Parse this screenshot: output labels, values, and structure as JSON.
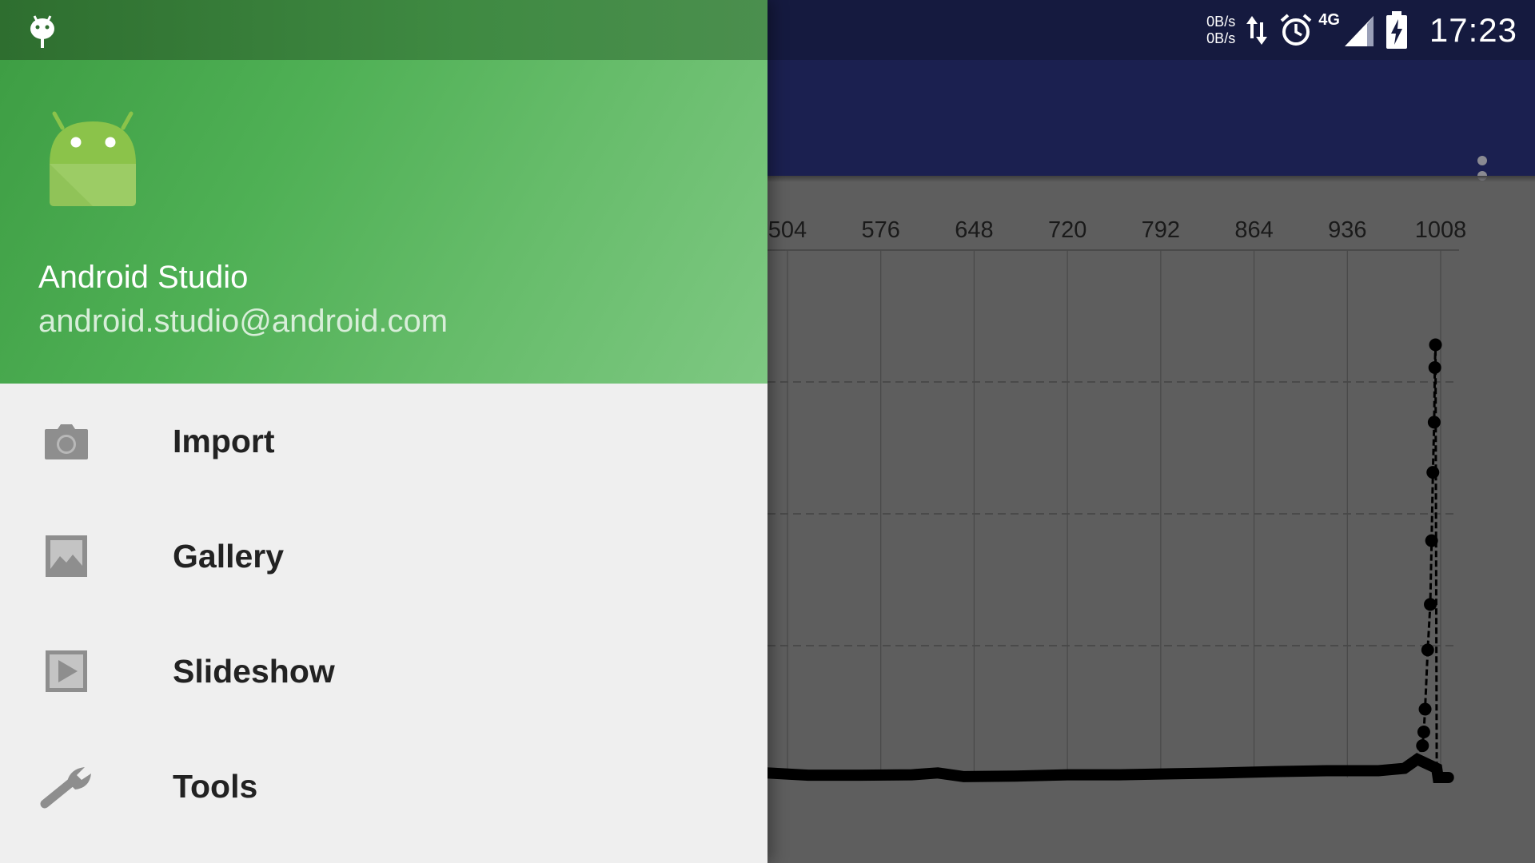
{
  "status_bar": {
    "net_up": "0B/s",
    "net_down": "0B/s",
    "network_type": "4G",
    "time": "17:23"
  },
  "drawer": {
    "header": {
      "name": "Android Studio",
      "email": "android.studio@android.com"
    },
    "items": [
      {
        "label": "Import",
        "icon": "camera-icon"
      },
      {
        "label": "Gallery",
        "icon": "gallery-icon"
      },
      {
        "label": "Slideshow",
        "icon": "slideshow-icon"
      },
      {
        "label": "Tools",
        "icon": "wrench-icon"
      }
    ]
  },
  "colors": {
    "header_green": "#4caf50",
    "app_toolbar": "#1b2050",
    "scrim_gray": "#5e5e5e"
  },
  "chart_data": {
    "type": "line",
    "x_ticks": [
      "504",
      "576",
      "648",
      "720",
      "792",
      "864",
      "936",
      "1008"
    ],
    "x_tick_values": [
      504,
      576,
      648,
      720,
      792,
      864,
      936,
      1008
    ],
    "xlim": [
      488,
      1024
    ],
    "ylim": [
      0,
      1
    ],
    "grid": true,
    "series": [
      {
        "style": "dashed-with-markers",
        "color": "#000000",
        "points": [
          [
            488,
            0.01
          ],
          [
            520,
            0.005
          ],
          [
            560,
            0.005
          ],
          [
            600,
            0.006
          ],
          [
            620,
            0.01
          ],
          [
            640,
            0.002
          ],
          [
            680,
            0.003
          ],
          [
            720,
            0.006
          ],
          [
            760,
            0.006
          ],
          [
            800,
            0.008
          ],
          [
            840,
            0.01
          ],
          [
            880,
            0.013
          ],
          [
            920,
            0.015
          ],
          [
            960,
            0.015
          ],
          [
            980,
            0.02
          ],
          [
            990,
            0.04
          ],
          [
            994,
            0.07
          ],
          [
            995,
            0.1
          ],
          [
            996,
            0.15
          ],
          [
            998,
            0.28
          ],
          [
            1000,
            0.38
          ],
          [
            1001,
            0.52
          ],
          [
            1002,
            0.67
          ],
          [
            1003,
            0.78
          ],
          [
            1003.5,
            0.9
          ],
          [
            1004,
            0.95
          ],
          [
            1005,
            0.02
          ],
          [
            1006,
            0.0
          ],
          [
            1012,
            0.0
          ],
          [
            1014,
            0.0
          ]
        ]
      }
    ]
  }
}
